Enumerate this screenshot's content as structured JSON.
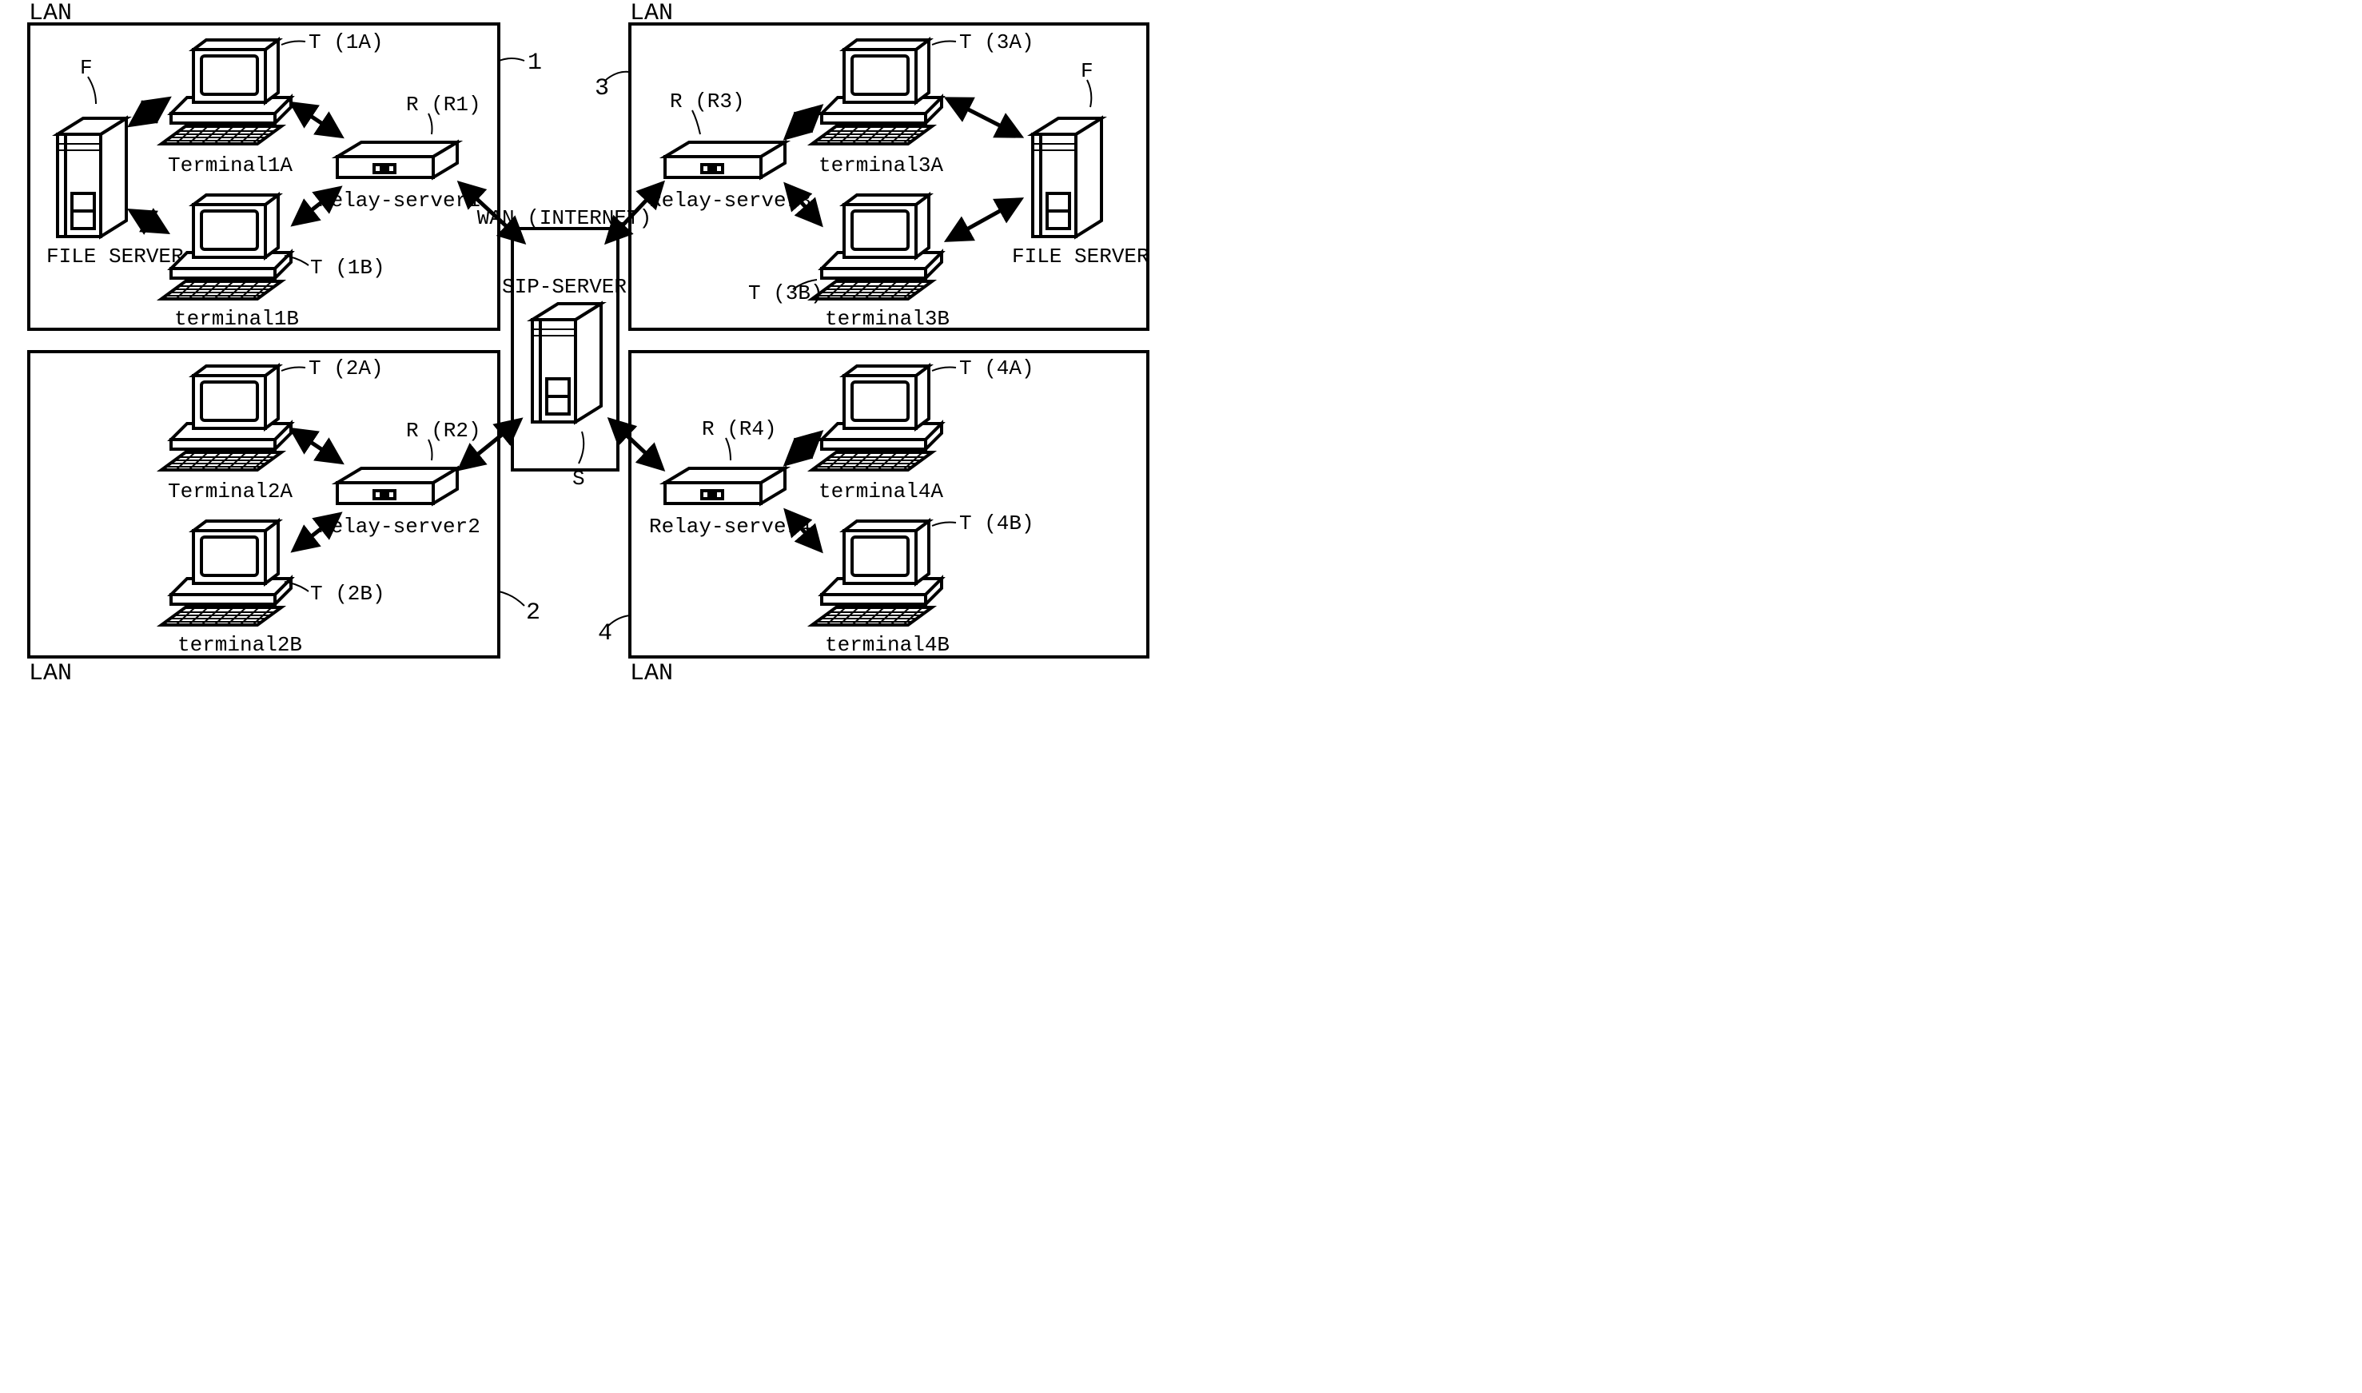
{
  "lan_label": "LAN",
  "wan_label": "WAN (INTERNET)",
  "sip_label": "SIP-SERVER",
  "sip_callout": "S",
  "lans": [
    {
      "id": "1",
      "relay": {
        "name": "Relay-server1",
        "callout": "R (R1)"
      },
      "file_server": {
        "name": "FILE SERVER",
        "callout": "F"
      },
      "terminals": [
        {
          "name": "Terminal1A",
          "callout": "T (1A)"
        },
        {
          "name": "terminal1B",
          "callout": "T (1B)"
        }
      ]
    },
    {
      "id": "2",
      "relay": {
        "name": "Relay-server2",
        "callout": "R (R2)"
      },
      "file_server": null,
      "terminals": [
        {
          "name": "Terminal2A",
          "callout": "T (2A)"
        },
        {
          "name": "terminal2B",
          "callout": "T (2B)"
        }
      ]
    },
    {
      "id": "3",
      "relay": {
        "name": "Relay-server3",
        "callout": "R (R3)"
      },
      "file_server": {
        "name": "FILE SERVER",
        "callout": "F"
      },
      "terminals": [
        {
          "name": "terminal3A",
          "callout": "T (3A)"
        },
        {
          "name": "terminal3B",
          "callout": "T (3B)"
        }
      ]
    },
    {
      "id": "4",
      "relay": {
        "name": "Relay-server4",
        "callout": "R (R4)"
      },
      "file_server": null,
      "terminals": [
        {
          "name": "terminal4A",
          "callout": "T (4A)"
        },
        {
          "name": "terminal4B",
          "callout": "T (4B)"
        }
      ]
    }
  ]
}
